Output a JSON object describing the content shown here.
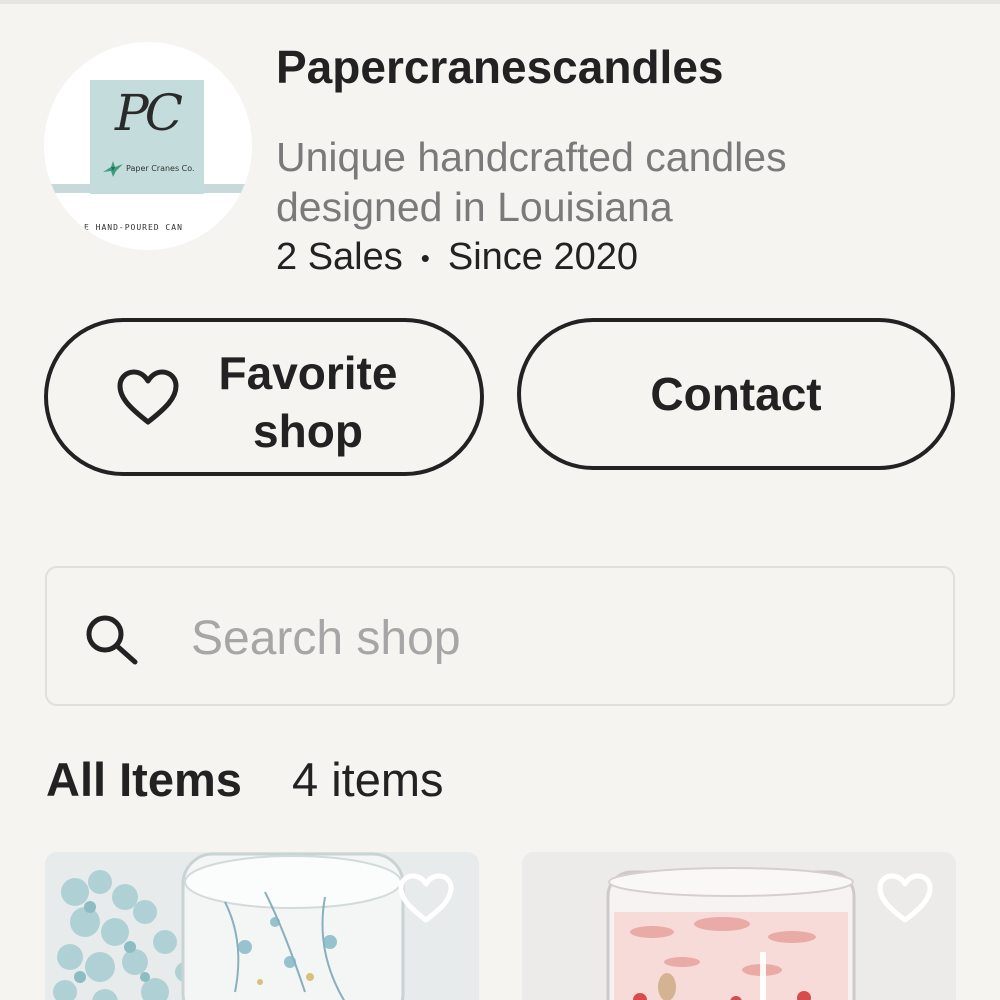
{
  "shop": {
    "name": "Papercranescandles",
    "description": "Unique handcrafted candles designed in Louisiana",
    "sales": "2 Sales",
    "separator": "•",
    "since": "Since 2020",
    "logo": {
      "initials": "PC",
      "brand": "Paper Cranes Co.",
      "tagline": "E HAND-POURED CAN"
    }
  },
  "actions": {
    "favorite_label": "Favorite shop",
    "contact_label": "Contact"
  },
  "search": {
    "placeholder": "Search shop",
    "value": ""
  },
  "items_section": {
    "title": "All Items",
    "count": "4 items"
  },
  "listings": [
    {
      "image": "light-blue hydrangea flowers beside a clear glass candle with dried blue flowers",
      "favorite_icon": "heart-outline-icon"
    },
    {
      "image": "clear glass candle with pink dried petals",
      "favorite_icon": "heart-outline-icon"
    }
  ],
  "colors": {
    "background": "#f5f4f1",
    "text": "#222222",
    "muted_text": "#7a7a7a",
    "placeholder": "#a6a6a6",
    "logo_teal": "#c5dcdc"
  }
}
